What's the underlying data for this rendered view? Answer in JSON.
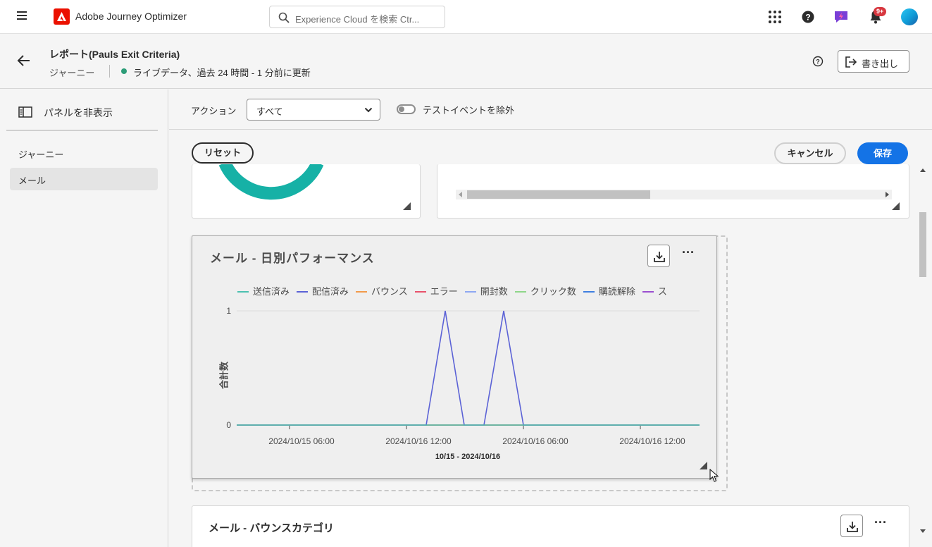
{
  "topnav": {
    "app_name": "Adobe Journey Optimizer",
    "search_placeholder": "Experience Cloud を検索 Ctr...",
    "notification_badge": "9+"
  },
  "header": {
    "title": "レポート(Pauls Exit Criteria)",
    "breadcrumb": "ジャーニー",
    "status": "ライブデータ、過去 24 時間 - 1 分前に更新",
    "export_label": "書き出し"
  },
  "leftpanel": {
    "hide_panel_label": "パネルを非表示",
    "items": [
      {
        "label": "ジャーニー",
        "selected": false
      },
      {
        "label": "メール",
        "selected": true
      }
    ]
  },
  "filters": {
    "action_label": "アクション",
    "action_value": "すべて",
    "exclude_test_label": "テストイベントを除外",
    "exclude_test_on": false
  },
  "toolbar": {
    "reset_label": "リセット",
    "cancel_label": "キャンセル",
    "save_label": "保存"
  },
  "chart_card": {
    "title": "メール - 日別パフォーマンス"
  },
  "bottom_card": {
    "title": "メール - バウンスカテゴリ"
  },
  "chart_data": {
    "type": "line",
    "title": "メール - 日別パフォーマンス",
    "ylabel": "合計数",
    "xlabel": "10/15 - 2024/10/16",
    "x_ticks": [
      "2024/10/15 06:00",
      "2024/10/16 12:00",
      "2024/10/16 06:00",
      "2024/10/16 12:00"
    ],
    "y_ticks": [
      0,
      1
    ],
    "ylim": [
      0,
      1
    ],
    "grid": true,
    "legend_position": "top",
    "series": [
      {
        "name": "送信済み",
        "color": "#4cc1b0",
        "values": [
          0,
          0,
          0,
          0,
          0,
          0,
          0,
          0,
          0,
          0
        ]
      },
      {
        "name": "配信済み",
        "color": "#5b62d6",
        "values": [
          0,
          0,
          0,
          0,
          1,
          0,
          0,
          1,
          0,
          0
        ]
      },
      {
        "name": "バウンス",
        "color": "#f29a4b",
        "values": [
          0,
          0,
          0,
          0,
          0,
          0,
          0,
          0,
          0,
          0
        ]
      },
      {
        "name": "エラー",
        "color": "#e8526b",
        "values": [
          0,
          0,
          0,
          0,
          0,
          0,
          0,
          0,
          0,
          0
        ]
      },
      {
        "name": "開封数",
        "color": "#8ea8f2",
        "values": [
          0,
          0,
          0,
          0,
          0,
          0,
          0,
          0,
          0,
          0
        ]
      },
      {
        "name": "クリック数",
        "color": "#8fd68a",
        "values": [
          0,
          0,
          0,
          0,
          0,
          0,
          0,
          0,
          0,
          0
        ]
      },
      {
        "name": "購読解除",
        "color": "#3f7fe0",
        "values": [
          0,
          0,
          0,
          0,
          0,
          0,
          0,
          0,
          0,
          0
        ]
      },
      {
        "name": "ス",
        "color": "#9a4fd0",
        "values": [
          0,
          0,
          0,
          0,
          0,
          0,
          0,
          0,
          0,
          0
        ]
      }
    ]
  }
}
